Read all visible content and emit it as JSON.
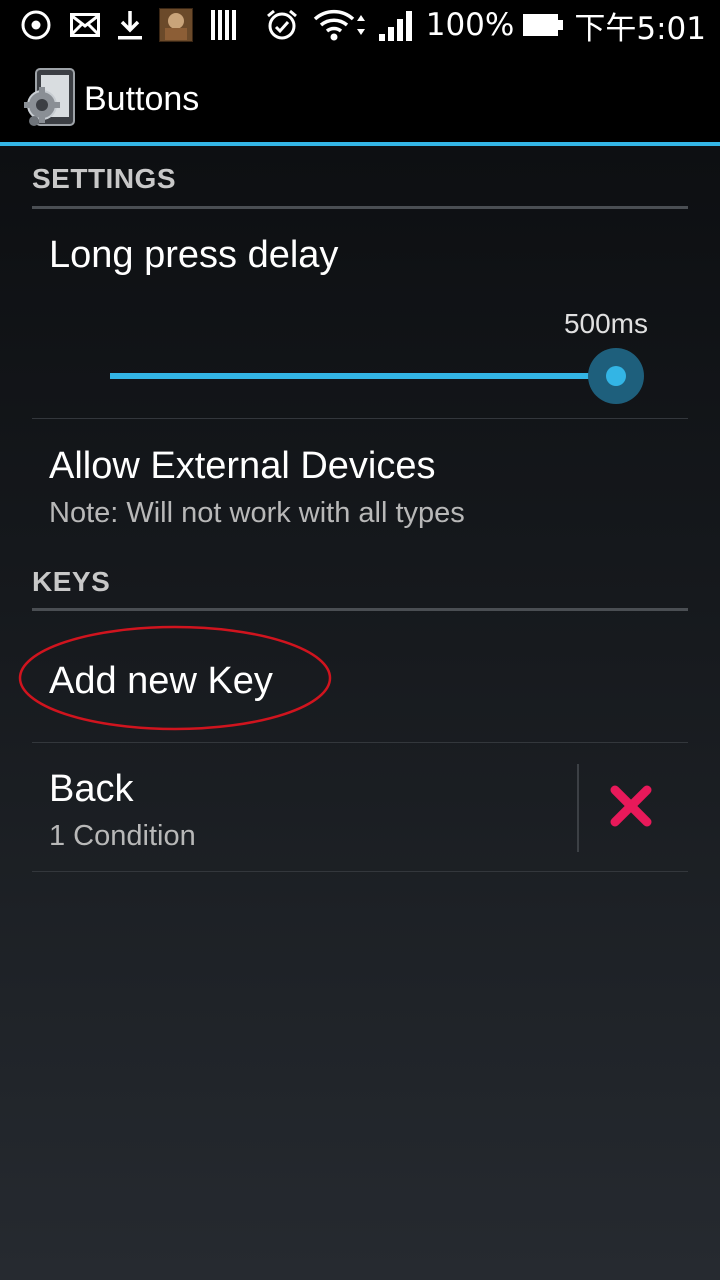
{
  "status_bar": {
    "battery_percent": "100%",
    "time": "下午5:01",
    "icons": [
      "sync-icon",
      "mail-icon",
      "download-icon",
      "app-thumbnail-icon",
      "barcode-icon",
      "alarm-icon",
      "wifi-icon",
      "signal-icon",
      "battery-icon"
    ]
  },
  "action_bar": {
    "title": "Buttons",
    "app_icon": "settings-phone-icon"
  },
  "settings": {
    "header": "SETTINGS",
    "long_press": {
      "title": "Long press delay",
      "value": "500ms",
      "slider_fraction": 1.0
    },
    "external": {
      "title": "Allow External Devices",
      "subtitle": "Note: Will not work with all types"
    }
  },
  "keys": {
    "header": "KEYS",
    "add_label": "Add new Key",
    "items": [
      {
        "title": "Back",
        "subtitle": "1 Condition",
        "delete_icon": "delete-x-icon"
      }
    ]
  },
  "colors": {
    "accent": "#33b5e5",
    "highlight_ellipse": "#d0141e",
    "delete": "#e8195a"
  }
}
